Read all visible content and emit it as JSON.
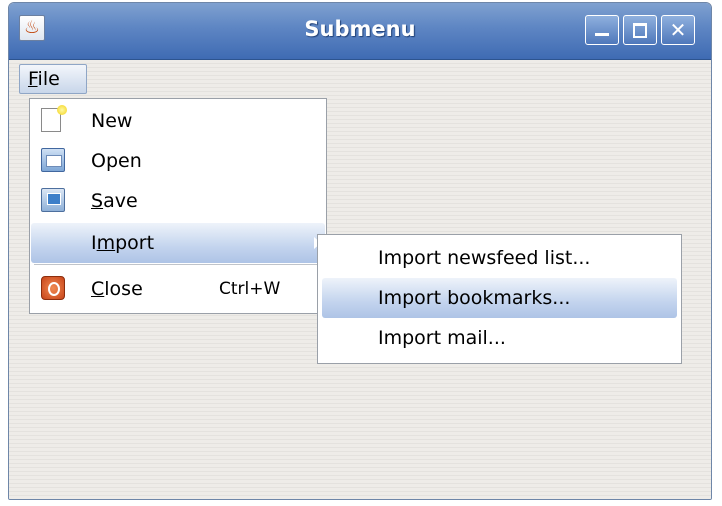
{
  "window": {
    "title": "Submenu",
    "icon": "java-coffee-icon",
    "controls": [
      "minimize-icon",
      "maximize-icon",
      "close-icon"
    ]
  },
  "menubar": {
    "file": {
      "mnemonic": "F",
      "rest": "ile"
    }
  },
  "file_menu": {
    "items": [
      {
        "label": "New",
        "icon": "new-document-icon"
      },
      {
        "label": "Open",
        "icon": "open-folder-icon"
      },
      {
        "mnemonic": "S",
        "rest": "ave",
        "icon": "save-icon"
      },
      {
        "pre": "I",
        "mnemonic": "m",
        "rest": "port",
        "has_submenu": true,
        "selected": true
      },
      {
        "mnemonic": "C",
        "rest": "lose",
        "accelerator": "Ctrl+W",
        "icon": "close-app-icon"
      }
    ]
  },
  "import_menu": {
    "items": [
      {
        "label": "Import newsfeed list..."
      },
      {
        "label": "Import bookmarks...",
        "selected": true
      },
      {
        "label": "Import mail..."
      }
    ]
  },
  "colors": {
    "titlebar": "#5d85c3",
    "selection": "#c3d4ee",
    "close_icon": "#c8451a"
  }
}
